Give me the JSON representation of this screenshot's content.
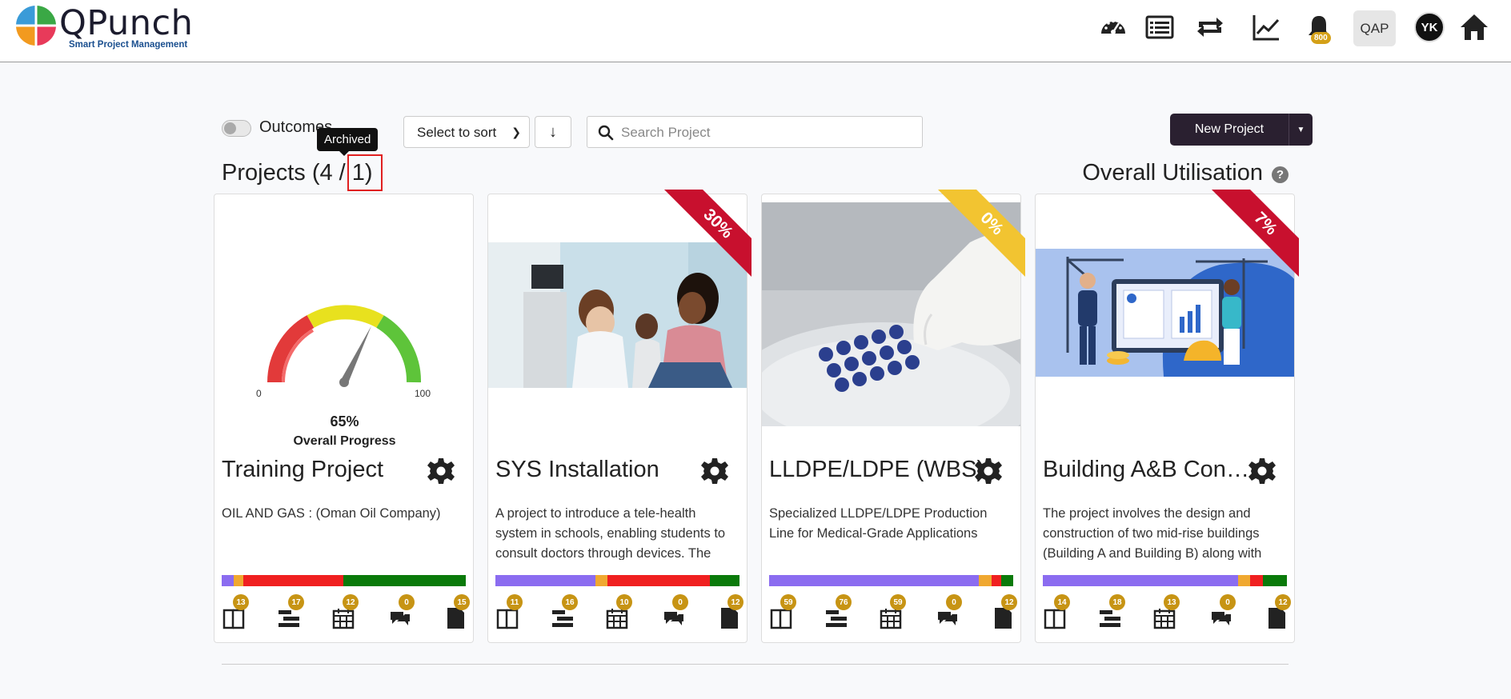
{
  "header": {
    "brand": "QPunch",
    "tagline": "Smart Project Management",
    "notification_count": "800",
    "qap_label": "QAP",
    "avatar_initials": "YK"
  },
  "toolbar": {
    "outcomes_label": "Outcomes",
    "tooltip": "Archived",
    "sort_label": "Select to sort",
    "sort_direction": "↓",
    "search_placeholder": "Search Project",
    "new_project_label": "New Project"
  },
  "summary": {
    "projects_title": "Projects (4 / 1)",
    "utilisation_title": "Overall Utilisation"
  },
  "colors": {
    "purple": "#8b6cf0",
    "amber": "#f0a830",
    "red": "#f02020",
    "green": "#0a7a0a",
    "badge": "#c79414",
    "ribbon_red": "#c8102e",
    "ribbon_yellow": "#f2c431"
  },
  "cards": [
    {
      "title": "Training Project",
      "description": "OIL AND GAS : (Oman Oil Company)",
      "media": "gauge",
      "gauge": {
        "min": "0",
        "max": "100",
        "value": "65%",
        "label": "Overall Progress",
        "fraction": 0.65
      },
      "progress": [
        0.05,
        0.04,
        0.41,
        0.5
      ],
      "stats": [
        "13",
        "17",
        "12",
        "0",
        "15"
      ]
    },
    {
      "title": "SYS Installation",
      "description": "A project to introduce a tele-health system in schools, enabling students to consult doctors through devices. The",
      "media": "photo-clinic",
      "ribbon": "30%",
      "ribbon_color": "red",
      "progress": [
        0.41,
        0.05,
        0.42,
        0.12
      ],
      "stats": [
        "11",
        "16",
        "10",
        "0",
        "12"
      ]
    },
    {
      "title": "LLDPE/LDPE (WBS)",
      "description": "Specialized LLDPE/LDPE Production Line for Medical-Grade Applications",
      "media": "photo-lab",
      "ribbon": "0%",
      "ribbon_color": "yellow",
      "progress": [
        0.86,
        0.05,
        0.04,
        0.05
      ],
      "stats": [
        "59",
        "76",
        "59",
        "0",
        "12"
      ]
    },
    {
      "title": "Building A&B Construction",
      "description": "The project involves the design and construction of two mid-rise buildings (Building A and Building B) along with",
      "media": "illustration-construction",
      "ribbon": "7%",
      "ribbon_color": "red",
      "progress": [
        0.8,
        0.05,
        0.05,
        0.1
      ],
      "stats": [
        "14",
        "18",
        "13",
        "0",
        "12"
      ]
    }
  ]
}
